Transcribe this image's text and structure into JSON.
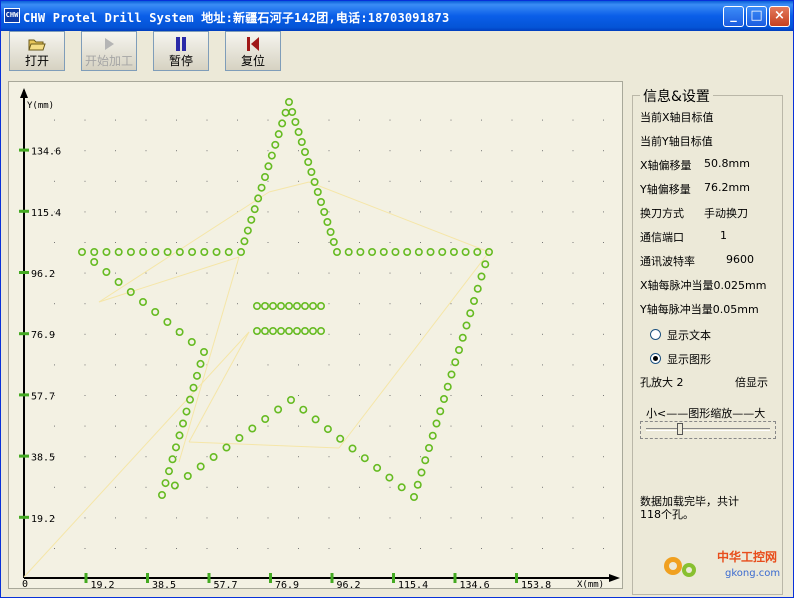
{
  "window": {
    "title": "CHW Protel Drill System 地址:新疆石河子142团,电话:18703091873",
    "minimize": "_",
    "maximize": "□",
    "close": "×",
    "icon_text": "CHW"
  },
  "toolbar": {
    "open": "打开",
    "start": "开始加工",
    "pause": "暂停",
    "reset": "复位"
  },
  "panel": {
    "title": "信息&设置",
    "x_target_label": "当前X轴目标值",
    "y_target_label": "当前Y轴目标值",
    "x_offset_label": "X轴偏移量",
    "x_offset_value": "50.8mm",
    "y_offset_label": "Y轴偏移量",
    "y_offset_value": "76.2mm",
    "tool_change_label": "换刀方式",
    "tool_change_value": "手动换刀",
    "port_label": "通信端口",
    "port_value": "1",
    "baud_label": "通讯波特率",
    "baud_value": "9600",
    "x_pulse_label": "X轴每脉冲当量",
    "x_pulse_value": "0.025mm",
    "y_pulse_label": "Y轴每脉冲当量",
    "y_pulse_value": "0.05mm",
    "show_text": "显示文本",
    "show_graph": "显示图形",
    "hole_zoom_label": "孔放大 2",
    "hole_zoom_suffix": "倍显示",
    "zoom_slider_label": "小<——图形缩放——大",
    "status_line1": "数据加载完毕，共计",
    "status_line2": "118个孔。"
  },
  "plot": {
    "y_label": "Y(mm)",
    "x_label": "X(mm)",
    "origin": "0",
    "y_ticks": [
      "19.2",
      "38.5",
      "57.7",
      "76.9",
      "96.2",
      "115.4",
      "134.6"
    ],
    "x_ticks": [
      "19.2",
      "38.5",
      "57.7",
      "76.9",
      "96.2",
      "115.4",
      "134.6",
      "153.8"
    ],
    "hole_color": "#66bb22",
    "path_color": "#f5e6a8"
  },
  "watermark": {
    "text_cn": "中华工控网",
    "text_en": "gkong.com"
  }
}
